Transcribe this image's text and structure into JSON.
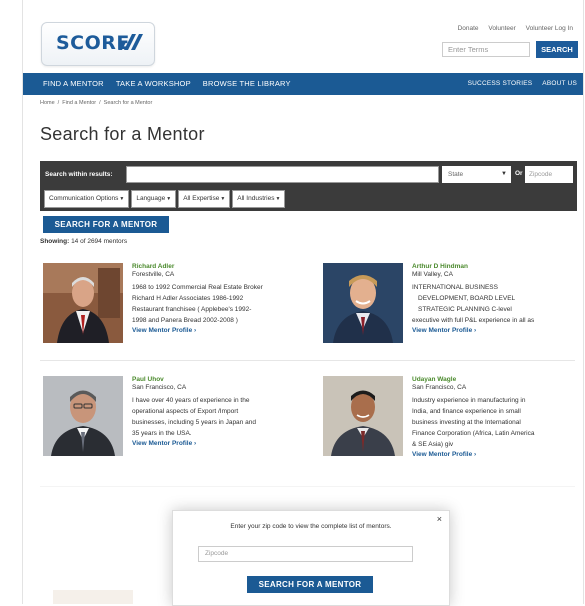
{
  "header": {
    "logo_text": "SCORE",
    "top_links": [
      "Donate",
      "Volunteer",
      "Volunteer Log In"
    ],
    "search_placeholder": "Enter Terms",
    "search_button": "SEARCH"
  },
  "nav": {
    "left": [
      "FIND A MENTOR",
      "TAKE A WORKSHOP",
      "BROWSE THE LIBRARY"
    ],
    "right": [
      "SUCCESS STORIES",
      "ABOUT US"
    ]
  },
  "breadcrumb": [
    "Home",
    "Find a Mentor",
    "Search for a Mentor"
  ],
  "page_title": "Search for a Mentor",
  "filters": {
    "within_label": "Search within results:",
    "state_label": "State",
    "or_label": "Or",
    "zip_placeholder": "Zipcode",
    "dropdowns": [
      "Communication Options",
      "Language",
      "All Expertise",
      "All Industries"
    ],
    "search_button": "SEARCH FOR A MENTOR"
  },
  "showing": {
    "label": "Showing:",
    "text": "14 of 2694 mentors"
  },
  "mentors": [
    {
      "name": "Richard Adler",
      "location": "Forestville, CA",
      "desc": [
        "1968 to 1992 Commercial Real Estate Broker",
        "Richard H Adler Associates 1986-1992",
        "Restaurant franchisee ( Applebee's 1992-",
        "1998 and Panera Bread 2002-2008 )"
      ],
      "link": "View Mentor Profile ›"
    },
    {
      "name": "Arthur D Hindman",
      "location": "Mill Valley, CA",
      "desc": [
        "INTERNATIONAL BUSINESS",
        "DEVELOPMENT, BOARD LEVEL",
        "STRATEGIC PLANNING   C-level",
        "executive with full P&L experience in all as"
      ],
      "link": "View Mentor Profile ›"
    },
    {
      "name": "Paul Uhov",
      "location": "San Francisco, CA",
      "desc": [
        "I have over 40 years of experience in the",
        "operational aspects of Export /Import",
        "businesses, including 5 years in Japan and",
        "35 years in the USA."
      ],
      "link": "View Mentor Profile ›"
    },
    {
      "name": "Udayan Wagle",
      "location": "San Francisco, CA",
      "desc": [
        "Industry experience in manufacturing in",
        "India, and finance experience in small",
        "business investing at the International",
        "Finance Corporation (Africa, Latin America",
        "& SE Asia) giv"
      ],
      "link": "View Mentor Profile ›"
    }
  ],
  "modal": {
    "message": "Enter your zip code to view the complete list of mentors.",
    "close": "×",
    "zip_placeholder": "Zipcode",
    "button": "SEARCH FOR A MENTOR"
  },
  "colors": {
    "brand_blue": "#1b5a94",
    "name_green": "#4b8a2d",
    "filter_bg": "#3b3b3b"
  }
}
